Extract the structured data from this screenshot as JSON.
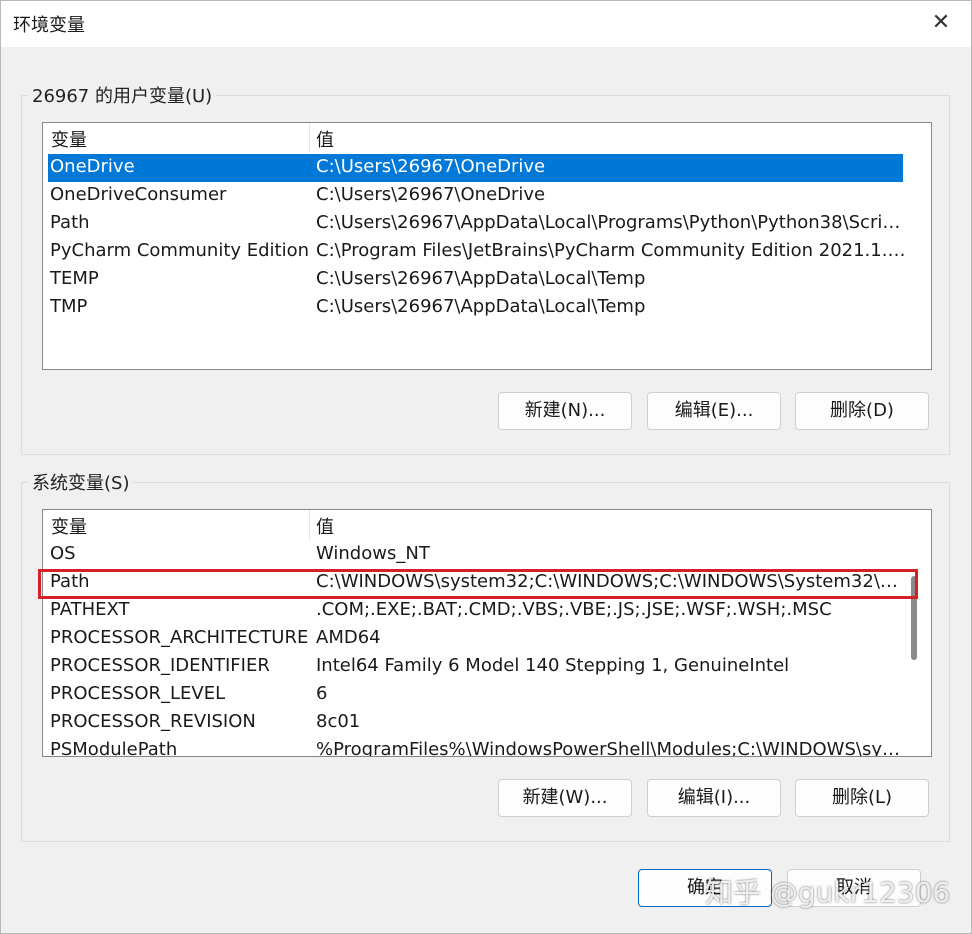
{
  "window": {
    "title": "环境变量",
    "close_glyph": "✕"
  },
  "user_vars": {
    "legend": "26967 的用户变量(U)",
    "header": {
      "name": "变量",
      "value": "值"
    },
    "rows": [
      {
        "name": "OneDrive",
        "value": "C:\\Users\\26967\\OneDrive",
        "selected": true
      },
      {
        "name": "OneDriveConsumer",
        "value": "C:\\Users\\26967\\OneDrive"
      },
      {
        "name": "Path",
        "value": "C:\\Users\\26967\\AppData\\Local\\Programs\\Python\\Python38\\Scrip..."
      },
      {
        "name": "PyCharm Community Edition",
        "value": "C:\\Program Files\\JetBrains\\PyCharm Community Edition 2021.1.3\\..."
      },
      {
        "name": "TEMP",
        "value": "C:\\Users\\26967\\AppData\\Local\\Temp"
      },
      {
        "name": "TMP",
        "value": "C:\\Users\\26967\\AppData\\Local\\Temp"
      }
    ],
    "buttons": {
      "new": "新建(N)...",
      "edit": "编辑(E)...",
      "delete": "删除(D)"
    }
  },
  "system_vars": {
    "legend": "系统变量(S)",
    "header": {
      "name": "变量",
      "value": "值"
    },
    "rows": [
      {
        "name": "OS",
        "value": "Windows_NT"
      },
      {
        "name": "Path",
        "value": "C:\\WINDOWS\\system32;C:\\WINDOWS;C:\\WINDOWS\\System32\\W..."
      },
      {
        "name": "PATHEXT",
        "value": ".COM;.EXE;.BAT;.CMD;.VBS;.VBE;.JS;.JSE;.WSF;.WSH;.MSC"
      },
      {
        "name": "PROCESSOR_ARCHITECTURE",
        "value": "AMD64"
      },
      {
        "name": "PROCESSOR_IDENTIFIER",
        "value": "Intel64 Family 6 Model 140 Stepping 1, GenuineIntel"
      },
      {
        "name": "PROCESSOR_LEVEL",
        "value": "6"
      },
      {
        "name": "PROCESSOR_REVISION",
        "value": "8c01"
      },
      {
        "name": "PSModulePath",
        "value": "%ProgramFiles%\\WindowsPowerShell\\Modules;C:\\WINDOWS\\syst..."
      }
    ],
    "buttons": {
      "new": "新建(W)...",
      "edit": "编辑(I)...",
      "delete": "删除(L)"
    }
  },
  "footer": {
    "ok": "确定",
    "cancel": "取消"
  },
  "watermark": "知乎 @gukr12306",
  "colors": {
    "selection": "#0078d7",
    "highlight_box": "#d42027",
    "primary_border": "#0067c0"
  }
}
